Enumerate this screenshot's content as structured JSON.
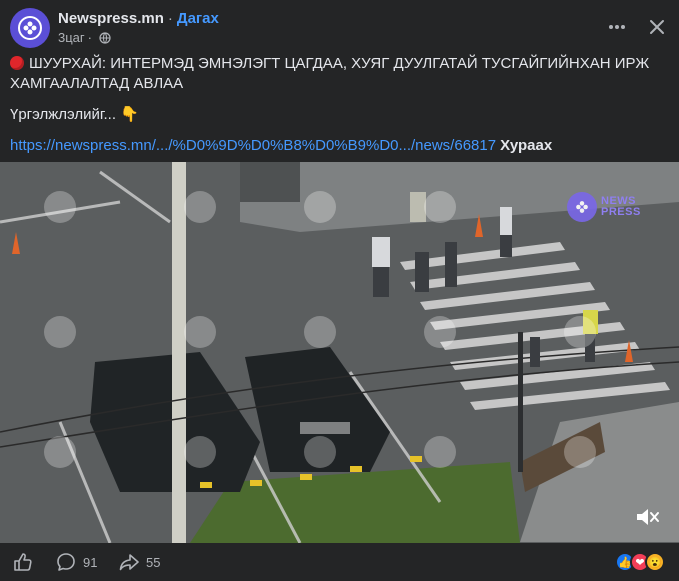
{
  "header": {
    "page_name": "Newspress.mn",
    "separator": "·",
    "follow_label": "Дагах",
    "time": "3цаг",
    "separator2": "·"
  },
  "post": {
    "headline": "ШУУРХАЙ: ИНТЕРМЭД ЭМНЭЛЭГТ ЦАГДАА, ХУЯГ ДУУЛГАТАЙ ТУСГАЙГИЙНХАН ИРЖ ХАМГААЛАЛТАД АВЛАА",
    "details": "Үргэлжлэлийг... 👇",
    "link_text": "https://newspress.mn/.../%D0%9D%D0%B8%D0%B9%D0.../news/66817",
    "collapse_label": "Хураах"
  },
  "video": {
    "watermark_line1": "NEWS",
    "watermark_line2": "PRESS"
  },
  "footer": {
    "comments_count": "91",
    "shares_count": "55"
  },
  "colors": {
    "background": "#242526",
    "text": "#e4e6eb",
    "secondary": "#b0b3b8",
    "link": "#4599ff",
    "brand": "#5b4fd6"
  },
  "icons": [
    "more-icon",
    "close-icon",
    "globe-icon",
    "like-icon",
    "comment-icon",
    "share-icon",
    "mute-icon"
  ]
}
